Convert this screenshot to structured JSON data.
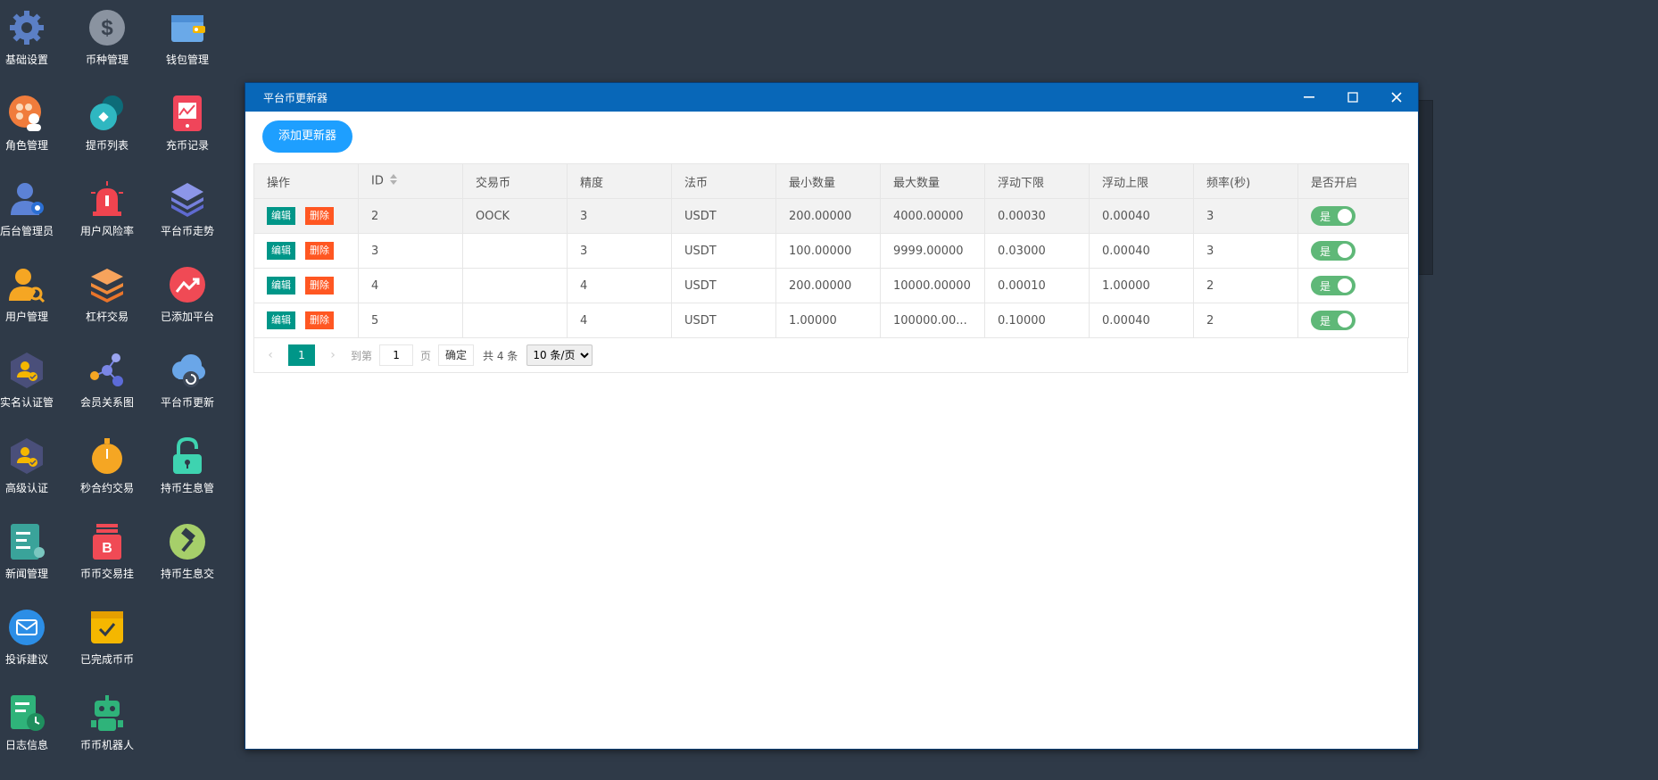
{
  "desktop_icons": [
    {
      "label": "基础设置",
      "icon": "gear-icon"
    },
    {
      "label": "币种管理",
      "icon": "dollar-icon"
    },
    {
      "label": "钱包管理",
      "icon": "wallet-icon"
    },
    {
      "label": "角色管理",
      "icon": "role-icon"
    },
    {
      "label": "提币列表",
      "icon": "withdraw-icon"
    },
    {
      "label": "充币记录",
      "icon": "deposit-icon"
    },
    {
      "label": "后台管理员",
      "icon": "admin-icon"
    },
    {
      "label": "用户风险率",
      "icon": "alarm-icon"
    },
    {
      "label": "平台币走势",
      "icon": "layers-icon"
    },
    {
      "label": "用户管理",
      "icon": "user-search-icon"
    },
    {
      "label": "杠杆交易",
      "icon": "stack-icon"
    },
    {
      "label": "已添加平台",
      "icon": "trend-icon"
    },
    {
      "label": "实名认证管",
      "icon": "verify-icon"
    },
    {
      "label": "会员关系图",
      "icon": "network-icon"
    },
    {
      "label": "平台币更新",
      "icon": "cloud-refresh-icon"
    },
    {
      "label": "高级认证",
      "icon": "advanced-verify-icon"
    },
    {
      "label": "秒合约交易",
      "icon": "stopwatch-icon"
    },
    {
      "label": "持币生息管",
      "icon": "lock-icon"
    },
    {
      "label": "新闻管理",
      "icon": "news-icon"
    },
    {
      "label": "币币交易挂",
      "icon": "bitcoin-icon"
    },
    {
      "label": "持币生息交",
      "icon": "hammer-icon"
    },
    {
      "label": "投诉建议",
      "icon": "mail-icon"
    },
    {
      "label": "已完成币币",
      "icon": "check-calendar-icon"
    },
    {
      "label": "日志信息",
      "icon": "log-icon"
    },
    {
      "label": "币币机器人",
      "icon": "robot-icon"
    }
  ],
  "window": {
    "title": "平台币更新器",
    "add_button": "添加更新器",
    "columns": [
      "操作",
      "ID",
      "交易币",
      "精度",
      "法币",
      "最小数量",
      "最大数量",
      "浮动下限",
      "浮动上限",
      "频率(秒)",
      "是否开启"
    ],
    "edit_label": "编辑",
    "delete_label": "删除",
    "switch_label": "是",
    "rows": [
      {
        "id": "2",
        "coin": "OOCK",
        "precision": "3",
        "fiat": "USDT",
        "min": "200.00000",
        "max": "4000.00000",
        "low": "0.00030",
        "high": "0.00040",
        "freq": "3"
      },
      {
        "id": "3",
        "coin": "",
        "precision": "3",
        "fiat": "USDT",
        "min": "100.00000",
        "max": "9999.00000",
        "low": "0.03000",
        "high": "0.00040",
        "freq": "3"
      },
      {
        "id": "4",
        "coin": "",
        "precision": "4",
        "fiat": "USDT",
        "min": "200.00000",
        "max": "10000.00000",
        "low": "0.00010",
        "high": "1.00000",
        "freq": "2"
      },
      {
        "id": "5",
        "coin": "",
        "precision": "4",
        "fiat": "USDT",
        "min": "1.00000",
        "max": "100000.00...",
        "low": "0.10000",
        "high": "0.00040",
        "freq": "2"
      }
    ],
    "pager": {
      "current": "1",
      "goto_label": "到第",
      "page_input": "1",
      "page_unit": "页",
      "confirm": "确定",
      "total": "共 4 条",
      "per_page": "10 条/页"
    }
  }
}
